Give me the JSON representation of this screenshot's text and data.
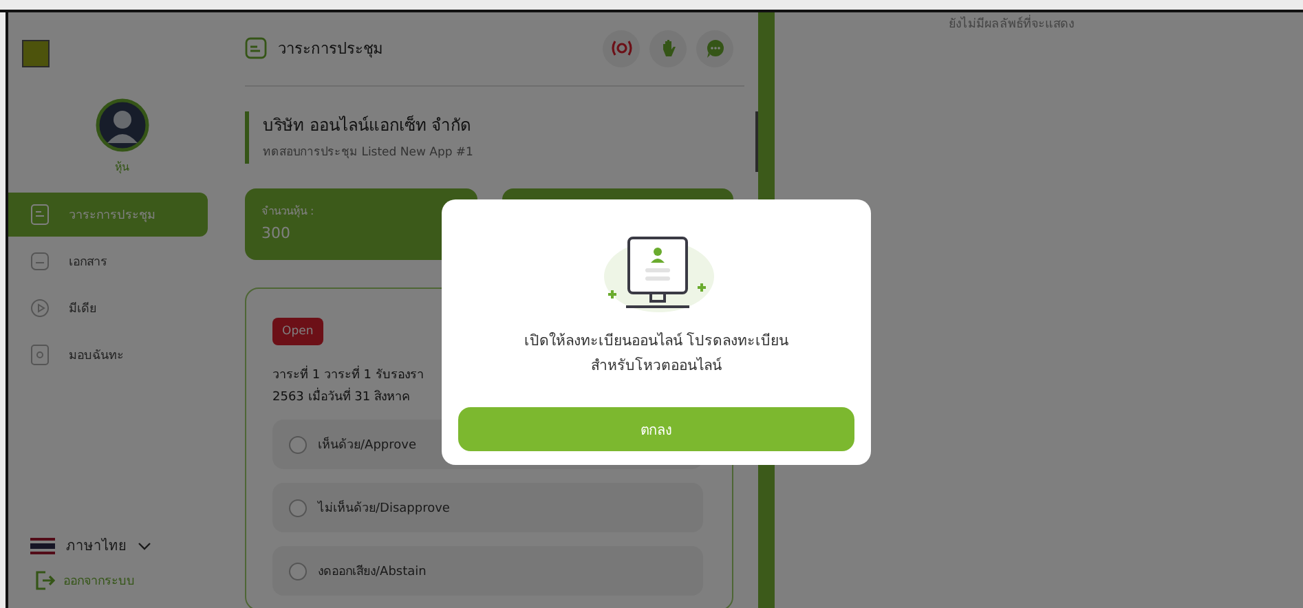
{
  "sidebar": {
    "user_label": "หุ้น",
    "items": [
      {
        "label": "วาระการประชุม",
        "selected": true
      },
      {
        "label": "เอกสาร",
        "selected": false
      },
      {
        "label": "มีเดีย",
        "selected": false
      },
      {
        "label": "มอบฉันทะ",
        "selected": false
      }
    ],
    "language": "ภาษาไทย",
    "logout": "ออกจากระบบ"
  },
  "main": {
    "title": "วาระการประชุม",
    "company": "บริษัท ออนไลน์แอกเซ็ท จำกัด",
    "meeting": "ทดสอบการประชุม Listed New App #1",
    "stats": [
      {
        "label": "จำนวนหุ้น :",
        "value": "300"
      }
    ],
    "agenda": {
      "status": "Open",
      "lines": [
        "วาระที่ 1 วาระที่ 1 รับรองรา",
        "2563 เมื่อวันที่ 31 สิงหาค"
      ],
      "options": [
        {
          "label": "เห็นด้วย/Approve",
          "selected": false
        },
        {
          "label": "ไม่เห็นด้วย/Disapprove",
          "selected": false
        },
        {
          "label": "งดออกเสียง/Abstain",
          "selected": false
        }
      ]
    }
  },
  "results": {
    "empty_text": "ยังไม่มีผลลัพธ์ที่จะแสดง"
  },
  "dialog": {
    "message": "เปิดให้ลงทะเบียนออนไลน์ โปรดลงทะเบียน\nสำหรับโหวตออนไลน์",
    "button": "ตกลง"
  }
}
